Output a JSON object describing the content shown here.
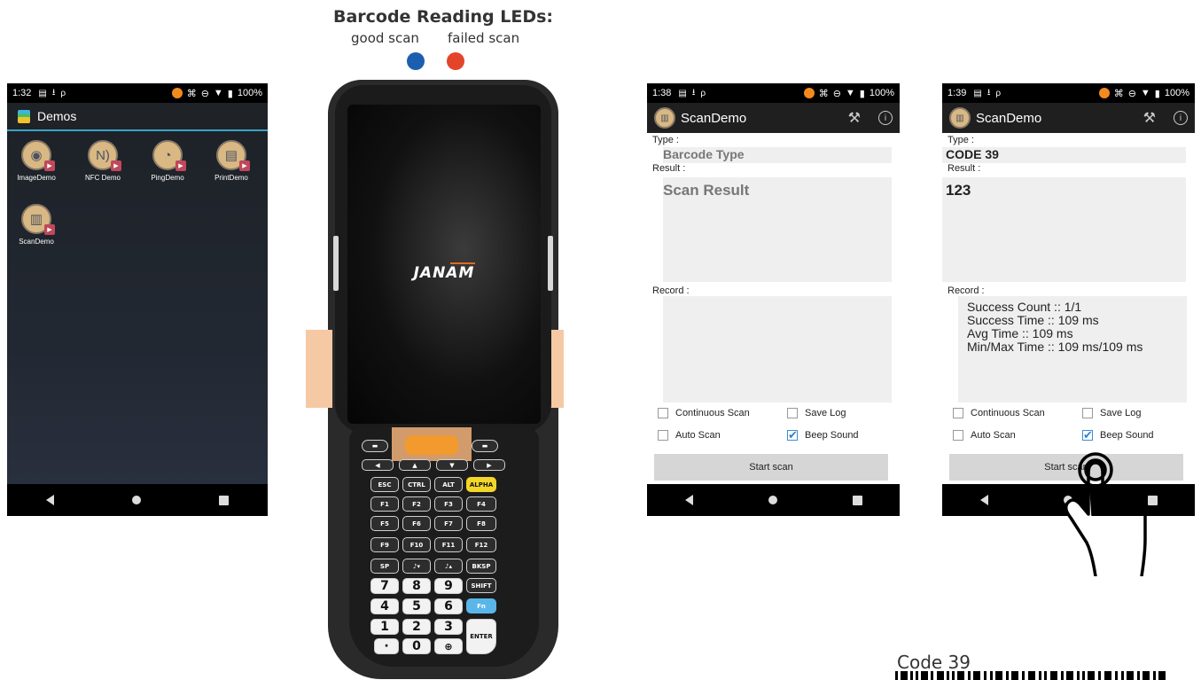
{
  "legend": {
    "title": "Barcode Reading LEDs:",
    "good_label": "good scan",
    "failed_label": "failed scan",
    "good_color": "#1c5fb0",
    "failed_color": "#e4452a"
  },
  "launcher": {
    "status": {
      "time": "1:32",
      "battery": "100%"
    },
    "title": "Demos",
    "apps": [
      {
        "label": "ImageDemo",
        "icon": "camera-icon"
      },
      {
        "label": "NFC Demo",
        "icon": "nfc-icon"
      },
      {
        "label": "PingDemo",
        "icon": "gauge-icon"
      },
      {
        "label": "PrintDemo",
        "icon": "printer-icon"
      },
      {
        "label": "ScanDemo",
        "icon": "barcode-scanner-icon"
      }
    ]
  },
  "device": {
    "brand": "JANAM",
    "keys": {
      "esc": "ESC",
      "ctrl": "CTRL",
      "alt": "ALT",
      "alpha": "ALPHA",
      "f1": "F1",
      "f2": "F2",
      "f3": "F3",
      "f4": "F4",
      "f5": "F5",
      "f6": "F6",
      "f7": "F7",
      "f8": "F8",
      "f9": "F9",
      "f10": "F10",
      "f11": "F11",
      "f12": "F12",
      "sp": "SP",
      "bksp": "BKSP",
      "shift": "SHIFT",
      "fn": "Fn",
      "enter": "ENTER",
      "n7": "7",
      "n8": "8",
      "n9": "9",
      "n4": "4",
      "n5": "5",
      "n6": "6",
      "n1": "1",
      "n2": "2",
      "n3": "3",
      "dot": "·",
      "n0": "0"
    }
  },
  "scan_before": {
    "status": {
      "time": "1:38",
      "battery": "100%"
    },
    "app_title": "ScanDemo",
    "type_label": "Type :",
    "type_value": "Barcode Type",
    "result_label": "Result :",
    "result_value": "Scan Result",
    "record_label": "Record :",
    "record_lines": [
      "",
      "",
      "",
      ""
    ],
    "continuous_scan": "Continuous Scan",
    "save_log": "Save Log",
    "auto_scan": "Auto Scan",
    "beep_sound": "Beep Sound",
    "start_scan": "Start scan"
  },
  "scan_after": {
    "status": {
      "time": "1:39",
      "battery": "100%"
    },
    "app_title": "ScanDemo",
    "type_label": "Type :",
    "type_value": "CODE 39",
    "result_label": "Result :",
    "result_value": "123",
    "record_label": "Record :",
    "record_lines": [
      "Success Count :: 1/1",
      "Success Time :: 109 ms",
      "Avg Time :: 109 ms",
      "Min/Max Time :: 109 ms/109 ms"
    ],
    "continuous_scan": "Continuous Scan",
    "save_log": "Save Log",
    "auto_scan": "Auto Scan",
    "beep_sound": "Beep Sound",
    "start_scan": "Start scan"
  },
  "code_sample": {
    "label": "Code 39"
  }
}
